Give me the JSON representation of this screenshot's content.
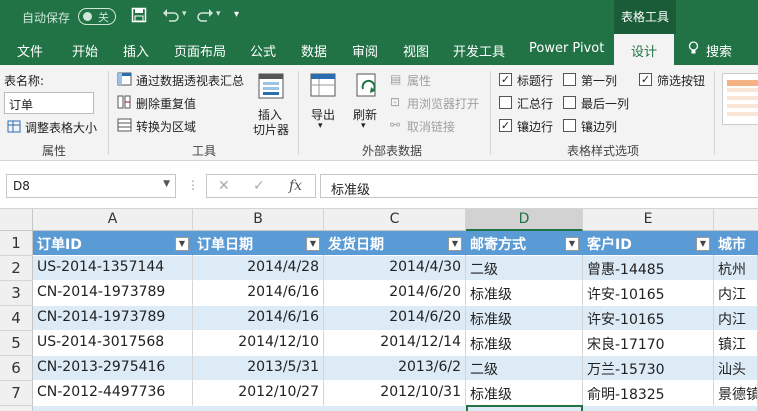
{
  "titlebar": {
    "autosave_label": "自动保存",
    "autosave_state": "关",
    "context_tab": "表格工具"
  },
  "tabs": [
    "文件",
    "开始",
    "插入",
    "页面布局",
    "公式",
    "数据",
    "审阅",
    "视图",
    "开发工具",
    "Power Pivot",
    "设计",
    "搜索"
  ],
  "ribbon": {
    "properties": {
      "table_name_label": "表名称:",
      "table_name_value": "订单",
      "resize_table": "调整表格大小",
      "group_label": "属性"
    },
    "tools": {
      "summarize_pivot": "通过数据透视表汇总",
      "remove_duplicates": "删除重复值",
      "convert_range": "转换为区域",
      "insert_slicer_line1": "插入",
      "insert_slicer_line2": "切片器",
      "group_label": "工具"
    },
    "external": {
      "export": "导出",
      "refresh": "刷新",
      "properties": "属性",
      "open_browser": "用浏览器打开",
      "unlink": "取消链接",
      "group_label": "外部表数据"
    },
    "style_options": {
      "header_row": "标题行",
      "total_row": "汇总行",
      "banded_rows": "镶边行",
      "first_column": "第一列",
      "last_column": "最后一列",
      "banded_columns": "镶边列",
      "filter_button": "筛选按钮",
      "header_row_checked": true,
      "total_row_checked": false,
      "banded_rows_checked": true,
      "first_column_checked": false,
      "last_column_checked": false,
      "banded_columns_checked": false,
      "filter_button_checked": true,
      "group_label": "表格样式选项"
    }
  },
  "formula_bar": {
    "cell_ref": "D8",
    "content": "标准级"
  },
  "grid": {
    "columns": [
      "A",
      "B",
      "C",
      "D",
      "E"
    ],
    "selected_column": "D",
    "row_numbers": [
      "1",
      "2",
      "3",
      "4",
      "5",
      "6",
      "7"
    ],
    "headers": [
      "订单ID",
      "订单日期",
      "发货日期",
      "邮寄方式",
      "客户ID",
      "城市"
    ],
    "rows": [
      [
        "US-2014-1357144",
        "2014/4/28",
        "2014/4/30",
        "二级",
        "曾惠-14485",
        "杭州"
      ],
      [
        "CN-2014-1973789",
        "2014/6/16",
        "2014/6/20",
        "标准级",
        "许安-10165",
        "内江"
      ],
      [
        "CN-2014-1973789",
        "2014/6/16",
        "2014/6/20",
        "标准级",
        "许安-10165",
        "内江"
      ],
      [
        "US-2014-3017568",
        "2014/12/10",
        "2014/12/14",
        "标准级",
        "宋良-17170",
        "镇江"
      ],
      [
        "CN-2013-2975416",
        "2013/5/31",
        "2013/6/2",
        "二级",
        "万兰-15730",
        "汕头"
      ],
      [
        "CN-2012-4497736",
        "2012/10/27",
        "2012/10/31",
        "标准级",
        "俞明-18325",
        "景德镇"
      ]
    ]
  }
}
